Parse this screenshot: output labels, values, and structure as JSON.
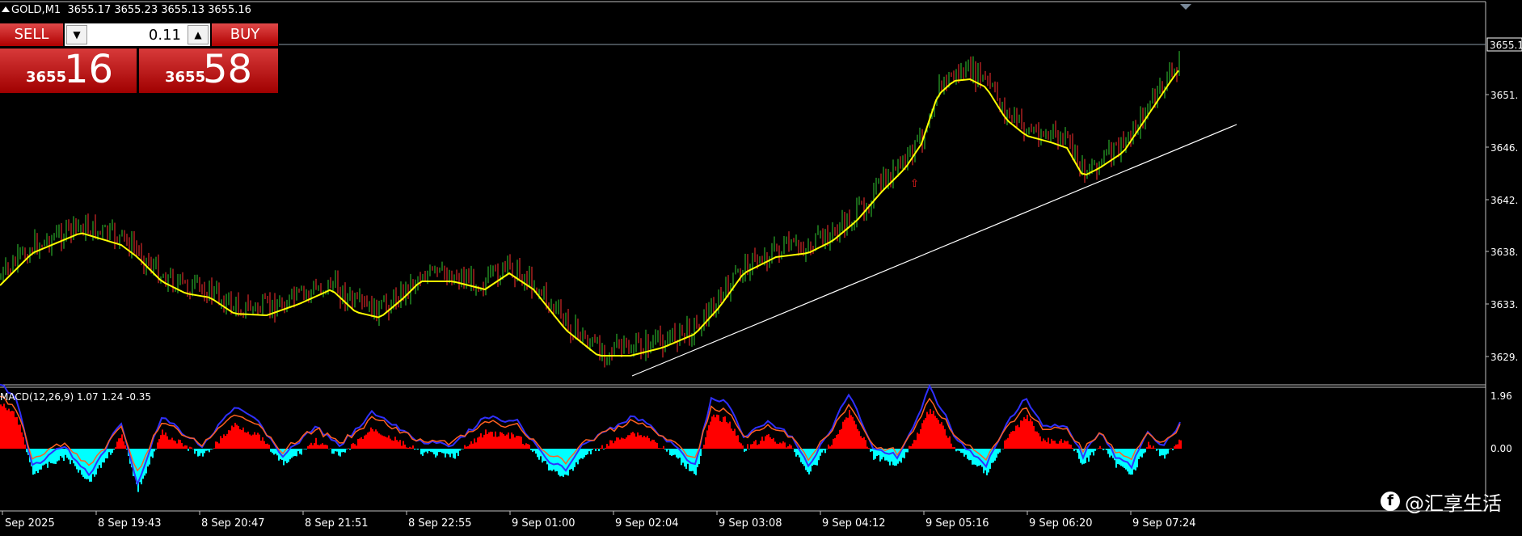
{
  "header": {
    "symbol_timeframe": "GOLD,M1",
    "ohlc": "3655.17 3655.23 3655.13 3655.16"
  },
  "trade_panel": {
    "sell_label": "SELL",
    "buy_label": "BUY",
    "volume": "0.11",
    "bid_prefix": "3655",
    "bid_big": "16",
    "ask_prefix": "3655",
    "ask_big": "58"
  },
  "price_axis": {
    "current_price_label": "3655.1",
    "ticks": [
      "3651.",
      "3646.",
      "3642.",
      "3638.",
      "3633.",
      "3629."
    ]
  },
  "macd": {
    "label": "MACD(12,26,9) 1.07 1.24 -0.35",
    "axis_max": "1.96",
    "axis_zero": "0.00"
  },
  "time_axis": {
    "labels": [
      "Sep 2025",
      "8 Sep 19:43",
      "8 Sep 20:47",
      "8 Sep 21:51",
      "8 Sep 22:55",
      "9 Sep 01:00",
      "9 Sep 02:04",
      "9 Sep 03:08",
      "9 Sep 04:12",
      "9 Sep 05:16",
      "9 Sep 06:20",
      "9 Sep 07:24"
    ]
  },
  "watermark": {
    "text": "@汇享生活",
    "icon": "facebook-icon"
  },
  "colors": {
    "bull": "#32cd32",
    "bear": "#ff3030",
    "ma": "#ffff00",
    "macd_pos": "#ff0000",
    "macd_neg": "#00ffff",
    "macd_line": "#3030ff",
    "signal_line": "#ff6020",
    "trendline": "#ffffff"
  }
}
